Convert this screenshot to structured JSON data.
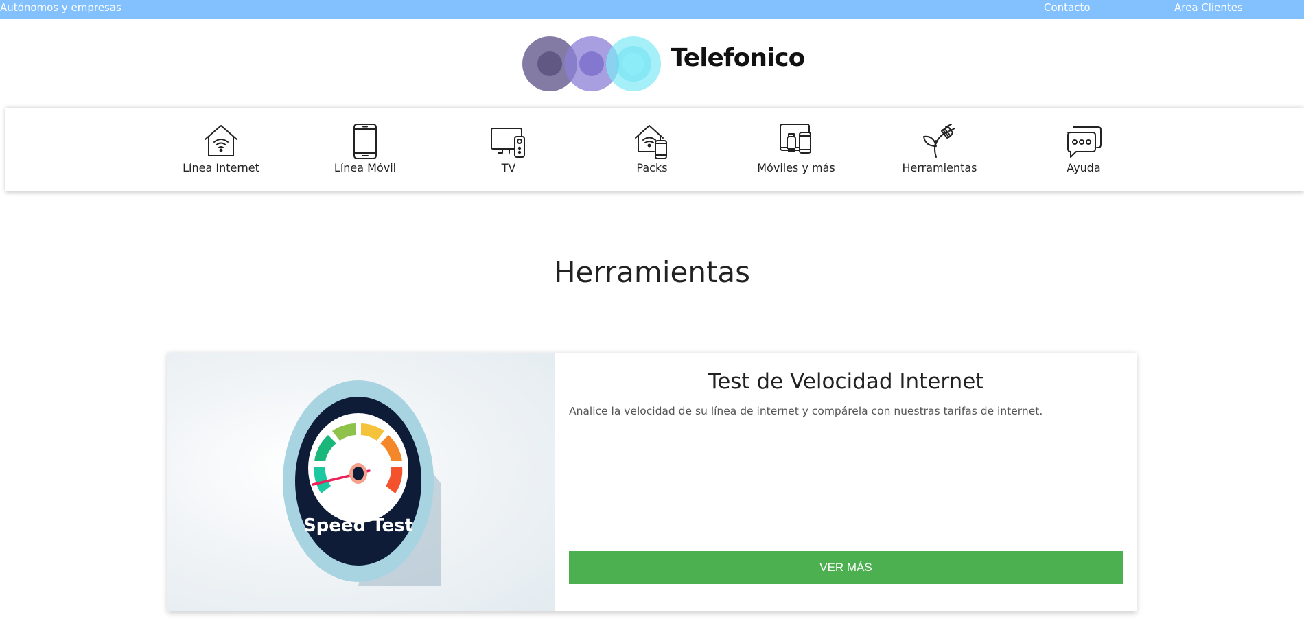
{
  "topbar": {
    "segment_link": "Autónomos y empresas",
    "contact_link": "Contacto",
    "client_area_link": "Area Clientes",
    "background_color": "#82c1fd"
  },
  "header": {
    "logo_text": "Telefonico",
    "logo_colors": [
      "#6e6494",
      "#8b7fd6",
      "#7fe8f5"
    ]
  },
  "nav": {
    "items": [
      {
        "label": "Línea Internet",
        "icon": "house-wifi-icon"
      },
      {
        "label": "Línea Móvil",
        "icon": "smartphone-icon"
      },
      {
        "label": "TV",
        "icon": "tv-remote-icon"
      },
      {
        "label": "Packs",
        "icon": "house-wifi-phone-icon"
      },
      {
        "label": "Móviles y más",
        "icon": "devices-icon"
      },
      {
        "label": "Herramientas",
        "icon": "plant-plug-icon"
      },
      {
        "label": "Ayuda",
        "icon": "chat-bubble-icon"
      }
    ]
  },
  "main": {
    "title": "Herramientas",
    "card": {
      "image_label": "Speed Test",
      "title": "Test de Velocidad Internet",
      "description": "Analice la velocidad de su línea de internet y compárela con nuestras tarifas de internet.",
      "button_label": "VER MÁS",
      "button_color": "#4caf50"
    }
  }
}
